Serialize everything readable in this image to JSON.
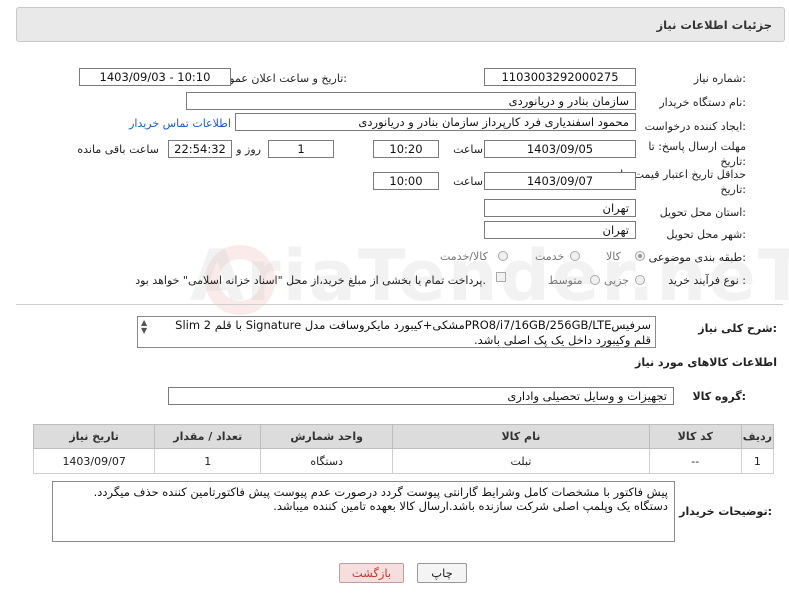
{
  "header": {
    "title": "جزئیات اطلاعات نیاز"
  },
  "fields": {
    "need_number_label": "شماره نیاز:",
    "need_number": "1103003292000275",
    "announce_label": "تاریخ و ساعت اعلان عمومی:",
    "announce_value": "1403/09/03 - 10:10",
    "buyer_org_label": "نام دستگاه خریدار:",
    "buyer_org": "سازمان بنادر و دریانوردی",
    "creator_label": "ایجاد کننده درخواست:",
    "creator": "محمود اسفندیاری فرد کارپرداز سازمان بنادر و دریانوردی",
    "contact_link": "اطلاعات تماس خریدار",
    "deadline_label_1": "مهلت ارسال پاسخ: تا",
    "deadline_label_2": "تاریخ:",
    "deadline_date": "1403/09/05",
    "time_label": "ساعت",
    "deadline_time": "10:20",
    "days_value": "1",
    "days_label": "روز و",
    "remaining_time": "22:54:32",
    "remaining_label": "ساعت باقی مانده",
    "price_validity_label_1": "حداقل تاریخ اعتبار قیمت: تا",
    "price_validity_label_2": "تاریخ:",
    "price_validity_date": "1403/09/07",
    "price_validity_time_label": "ساعت",
    "price_validity_time": "10:00",
    "province_label": "استان محل تحویل:",
    "province": "تهران",
    "city_label": "شهر محل تحویل:",
    "city": "تهران",
    "category_label": "طبقه بندی موضوعی:",
    "category_options": [
      "کالا",
      "خدمت",
      "کالا/خدمت"
    ],
    "process_label": "نوع فرآیند خرید :",
    "process_options": [
      "جزیی",
      "متوسط"
    ],
    "payment_text": "پرداخت تمام یا بخشی از مبلغ خرید،از محل \"اسناد خزانه اسلامی\" خواهد بود."
  },
  "description": {
    "label": "شرح کلی نیاز:",
    "text": "سرفیسPRO8/i7/16GB/256GB/LTEمشکی+کیبورد مایکروسافت مدل Signature با قلم Slim 2 قلم وکیبورد داخل یک پک اصلی باشد."
  },
  "goods_section": {
    "title": "اطلاعات کالاهای مورد نیاز",
    "group_label": "گروه کالا:",
    "group_value": "تجهیزات و وسایل تحصیلی واداری"
  },
  "table": {
    "headers": [
      "ردیف",
      "کد کالا",
      "نام کالا",
      "واحد شمارش",
      "تعداد / مقدار",
      "تاریخ نیاز"
    ],
    "rows": [
      [
        "1",
        "--",
        "تبلت",
        "دستگاه",
        "1",
        "1403/09/07"
      ]
    ]
  },
  "buyer_notes": {
    "label": "توضیحات خریدار:",
    "text": "پیش فاکتور با مشخصات کامل وشرایط گارانتی پیوست گردد درصورت عدم پیوست پیش فاکتورتامین کننده حذف میگردد. دستگاه یک وپلمپ اصلی شرکت سازنده باشد.ارسال کالا بعهده تامین کننده میباشد."
  },
  "buttons": {
    "print": "چاپ",
    "back": "بازگشت"
  },
  "watermark": "AriaTender.neT",
  "colors": {
    "link": "#1a5fb4",
    "back_button_bg": "#f6dede",
    "back_button_text": "#c0392b"
  }
}
